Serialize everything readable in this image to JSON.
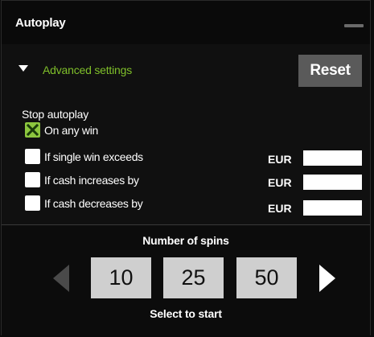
{
  "window": {
    "title": "Autoplay",
    "minimize_icon": "minimize-icon"
  },
  "advanced": {
    "label": "Advanced settings",
    "expanded_icon": "triangle-down-icon",
    "reset_label": "Reset",
    "label_color": "#7fbf2a"
  },
  "stop": {
    "heading": "Stop autoplay",
    "options": [
      {
        "label": "On any win",
        "checked": true
      },
      {
        "label": "If single win exceeds",
        "checked": false,
        "currency": "EUR",
        "value": ""
      },
      {
        "label": "If cash increases by",
        "checked": false,
        "currency": "EUR",
        "value": ""
      },
      {
        "label": "If cash decreases by",
        "checked": false,
        "currency": "EUR",
        "value": ""
      }
    ],
    "check_color": "#8cc63e"
  },
  "spins": {
    "title": "Number of spins",
    "choices": [
      "10",
      "25",
      "50"
    ],
    "prev_icon": "arrow-left-icon",
    "next_icon": "arrow-right-icon",
    "hint": "Select to start"
  }
}
